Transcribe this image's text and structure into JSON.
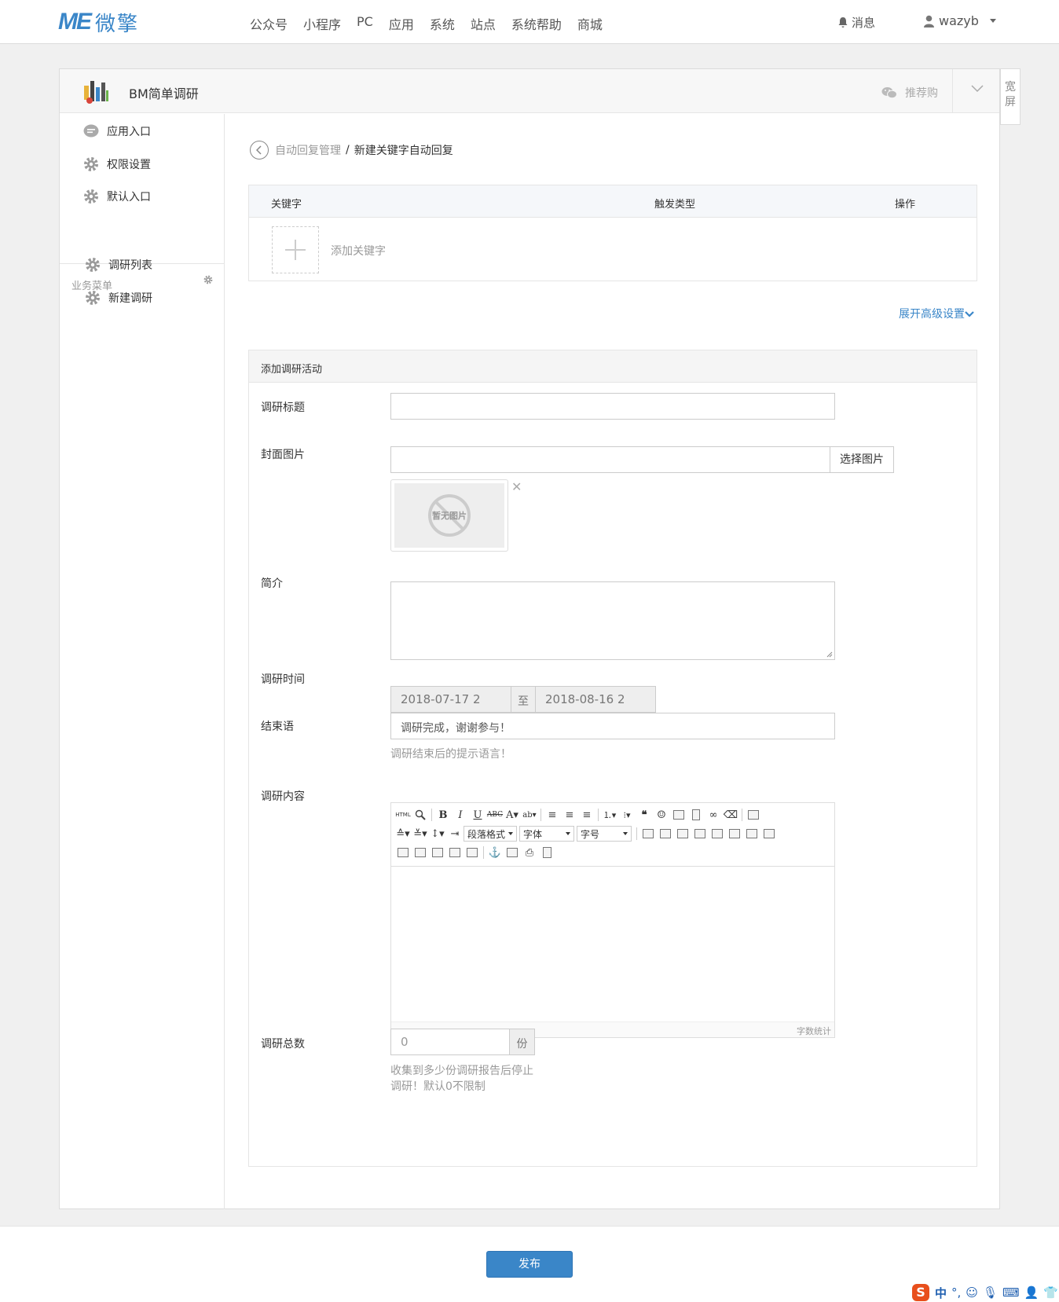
{
  "topnav": {
    "logo_mark": "ME",
    "logo_text": "微擎",
    "menu": [
      "公众号",
      "小程序",
      "PC",
      "应用",
      "系统",
      "站点",
      "系统帮助",
      "商城"
    ],
    "messages": "消息",
    "username": "wazyb"
  },
  "panel": {
    "app_title": "BM简单调研",
    "recommend": "推荐购",
    "wide_screen_1": "宽",
    "wide_screen_2": "屏"
  },
  "sidebar": {
    "items": [
      "应用入口",
      "权限设置",
      "默认入口"
    ],
    "section_title": "业务菜单",
    "section_items": [
      "调研列表",
      "新建调研"
    ]
  },
  "breadcrumb": {
    "parent": "自动回复管理",
    "separator": "/",
    "current": "新建关键字自动回复"
  },
  "keyword_table": {
    "columns": [
      "关键字",
      "触发类型",
      "操作"
    ],
    "add_label": "添加关键字"
  },
  "advanced_link": "展开高级设置",
  "form": {
    "title": "添加调研活动",
    "labels": {
      "title": "调研标题",
      "cover": "封面图片",
      "intro": "简介",
      "time": "调研时间",
      "ending": "结束语",
      "content": "调研内容",
      "total": "调研总数"
    },
    "cover_button": "选择图片",
    "no_image": "暂无图片",
    "date_start": "2018-07-17 2",
    "date_sep": "至",
    "date_end": "2018-08-16 2",
    "ending_value": "调研完成，谢谢参与！",
    "ending_help": "调研结束后的提示语言！",
    "editor": {
      "paragraph": "段落格式",
      "font": "字体",
      "size": "字号",
      "word_count": "字数统计"
    },
    "total_value": "0",
    "total_unit": "份",
    "total_help_1": "收集到多少份调研报告后停止",
    "total_help_2": "调研！默认0不限制"
  },
  "publish_button": "发布",
  "ime": {
    "logo": "S",
    "mode": "中",
    "punct": "°,"
  },
  "colors": {
    "brand": "#3a86c8",
    "border": "#e5e5e5"
  }
}
